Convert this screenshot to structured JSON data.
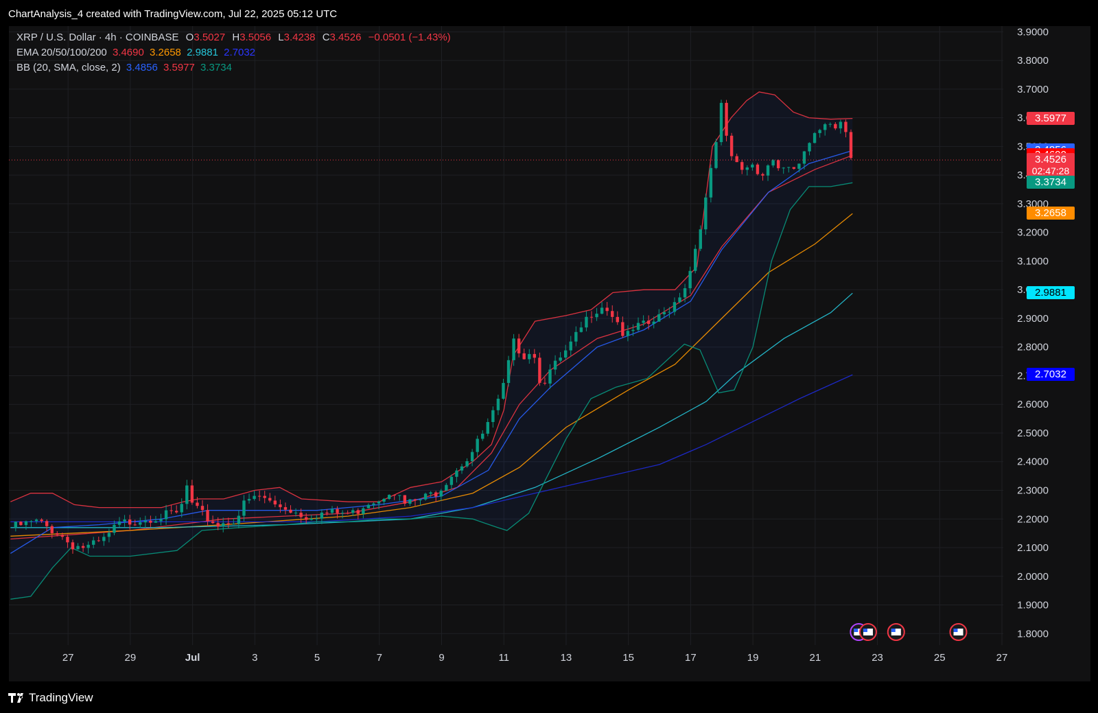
{
  "header": {
    "title": "ChartAnalysis_4 created with TradingView.com, Jul 22, 2025 05:12 UTC"
  },
  "legend": {
    "symbol": "XRP / U.S. Dollar · 4h · COINBASE",
    "o_label": "O",
    "o_value": "3.5027",
    "h_label": "H",
    "h_value": "3.5056",
    "l_label": "L",
    "l_value": "3.4238",
    "c_label": "C",
    "c_value": "3.4526",
    "change": "−0.0501 (−1.43%)",
    "ema_label": "EMA 20/50/100/200",
    "ema_values": [
      "3.4690",
      "3.2658",
      "2.9881",
      "2.7032"
    ],
    "bb_label": "BB (20, SMA, close, 2)",
    "bb_values": [
      "3.4856",
      "3.5977",
      "3.3734"
    ]
  },
  "price_tags": [
    {
      "text": "3.5977",
      "color": "#f23645",
      "value": 3.5977
    },
    {
      "text": "3.4856",
      "color": "#2962ff",
      "value": 3.4856
    },
    {
      "text": "3.4690",
      "color": "#ff0000",
      "value": 3.469
    },
    {
      "text": "3.4526",
      "sub": "02:47:28",
      "color": "#f23645",
      "value": 3.4526
    },
    {
      "text": "3.3734",
      "color": "#089981",
      "value": 3.3734
    },
    {
      "text": "3.2658",
      "color": "#ff8c00",
      "value": 3.2658
    },
    {
      "text": "2.9881",
      "color": "#00e5ff",
      "value": 2.9881
    },
    {
      "text": "2.7032",
      "color": "#0000ff",
      "value": 2.7032
    }
  ],
  "footer": {
    "brand": "TradingView"
  },
  "colors": {
    "up": "#089981",
    "down": "#f23645",
    "ema20": "#f23645",
    "ema50": "#ff9800",
    "ema100": "#26c6da",
    "ema200": "#1e2bd8",
    "bb_basis": "#2962ff",
    "bb_upper": "#f23645",
    "bb_lower": "#089981"
  },
  "chart_data": {
    "type": "candlestick",
    "symbol": "XRP / U.S. Dollar",
    "interval": "4h",
    "exchange": "COINBASE",
    "y_ticks": [
      "3.9000",
      "3.8000",
      "3.7000",
      "3.6000",
      "3.5000",
      "3.4000",
      "3.3000",
      "3.2000",
      "3.1000",
      "3.0000",
      "2.9000",
      "2.8000",
      "2.7000",
      "2.6000",
      "2.5000",
      "2.4000",
      "2.3000",
      "2.2000",
      "2.1000",
      "2.0000",
      "1.9000",
      "1.8000"
    ],
    "ylim": [
      1.76,
      3.92
    ],
    "x_ticks": [
      {
        "label": "27",
        "day": 27
      },
      {
        "label": "29",
        "day": 29
      },
      {
        "label": "Jul",
        "day": 31
      },
      {
        "label": "3",
        "day": 33
      },
      {
        "label": "5",
        "day": 35
      },
      {
        "label": "7",
        "day": 37
      },
      {
        "label": "9",
        "day": 39
      },
      {
        "label": "11",
        "day": 41
      },
      {
        "label": "13",
        "day": 43
      },
      {
        "label": "15",
        "day": 45
      },
      {
        "label": "17",
        "day": 47
      },
      {
        "label": "19",
        "day": 49
      },
      {
        "label": "21",
        "day": 51
      },
      {
        "label": "23",
        "day": 53
      },
      {
        "label": "25",
        "day": 55
      },
      {
        "label": "27",
        "day": 57
      }
    ],
    "xlim_days": [
      25.1,
      57.0
    ],
    "last_price": 3.4526,
    "close_points": [
      [
        25.15,
        2.17
      ],
      [
        26.0,
        2.19
      ],
      [
        26.7,
        2.15
      ],
      [
        27.1,
        2.11
      ],
      [
        27.6,
        2.1
      ],
      [
        28.1,
        2.12
      ],
      [
        28.6,
        2.18
      ],
      [
        29.3,
        2.2
      ],
      [
        30.0,
        2.21
      ],
      [
        30.6,
        2.22
      ],
      [
        30.8,
        2.32
      ],
      [
        31.0,
        2.24
      ],
      [
        31.5,
        2.2
      ],
      [
        31.8,
        2.18
      ],
      [
        32.4,
        2.2
      ],
      [
        32.7,
        2.26
      ],
      [
        33.2,
        2.28
      ],
      [
        33.6,
        2.25
      ],
      [
        34.0,
        2.24
      ],
      [
        34.6,
        2.21
      ],
      [
        35.2,
        2.22
      ],
      [
        35.8,
        2.22
      ],
      [
        36.2,
        2.22
      ],
      [
        36.6,
        2.26
      ],
      [
        37.0,
        2.27
      ],
      [
        37.4,
        2.31
      ],
      [
        37.8,
        2.25
      ],
      [
        38.4,
        2.27
      ],
      [
        38.9,
        2.3
      ],
      [
        39.4,
        2.37
      ],
      [
        39.9,
        2.42
      ],
      [
        40.4,
        2.51
      ],
      [
        40.8,
        2.6
      ],
      [
        41.1,
        2.7
      ],
      [
        41.3,
        2.85
      ],
      [
        41.6,
        2.76
      ],
      [
        41.9,
        2.8
      ],
      [
        42.2,
        2.67
      ],
      [
        42.6,
        2.73
      ],
      [
        43.0,
        2.78
      ],
      [
        43.4,
        2.85
      ],
      [
        43.8,
        2.92
      ],
      [
        44.2,
        2.95
      ],
      [
        44.6,
        2.9
      ],
      [
        44.9,
        2.83
      ],
      [
        45.3,
        2.87
      ],
      [
        45.7,
        2.88
      ],
      [
        46.1,
        2.91
      ],
      [
        46.5,
        2.96
      ],
      [
        46.9,
        3.03
      ],
      [
        47.2,
        3.17
      ],
      [
        47.5,
        3.32
      ],
      [
        47.8,
        3.5
      ],
      [
        48.0,
        3.65
      ],
      [
        48.2,
        3.48
      ],
      [
        48.6,
        3.42
      ],
      [
        49.0,
        3.44
      ],
      [
        49.3,
        3.4
      ],
      [
        49.6,
        3.46
      ],
      [
        49.9,
        3.42
      ],
      [
        50.2,
        3.41
      ],
      [
        50.5,
        3.44
      ],
      [
        50.8,
        3.5
      ],
      [
        51.1,
        3.55
      ],
      [
        51.4,
        3.6
      ],
      [
        51.7,
        3.57
      ],
      [
        51.9,
        3.6
      ],
      [
        52.1,
        3.5
      ],
      [
        52.2,
        3.4526
      ]
    ],
    "series": [
      {
        "name": "EMA 20",
        "last": 3.469,
        "points": [
          [
            25.15,
            2.13
          ],
          [
            29,
            2.16
          ],
          [
            32,
            2.2
          ],
          [
            36,
            2.22
          ],
          [
            38,
            2.26
          ],
          [
            39.5,
            2.31
          ],
          [
            40.6,
            2.43
          ],
          [
            41.5,
            2.6
          ],
          [
            42.5,
            2.72
          ],
          [
            44,
            2.83
          ],
          [
            45.5,
            2.88
          ],
          [
            47,
            2.98
          ],
          [
            48,
            3.15
          ],
          [
            49.5,
            3.34
          ],
          [
            51,
            3.42
          ],
          [
            52.2,
            3.469
          ]
        ]
      },
      {
        "name": "EMA 50",
        "last": 3.2658,
        "points": [
          [
            25.15,
            2.14
          ],
          [
            29,
            2.16
          ],
          [
            32,
            2.18
          ],
          [
            36,
            2.21
          ],
          [
            38,
            2.24
          ],
          [
            40,
            2.29
          ],
          [
            41.5,
            2.38
          ],
          [
            43,
            2.52
          ],
          [
            45,
            2.65
          ],
          [
            46.5,
            2.74
          ],
          [
            48,
            2.9
          ],
          [
            49.5,
            3.06
          ],
          [
            51,
            3.16
          ],
          [
            52.2,
            3.2658
          ]
        ]
      },
      {
        "name": "EMA 100",
        "last": 2.9881,
        "points": [
          [
            25.15,
            2.17
          ],
          [
            30,
            2.17
          ],
          [
            34,
            2.18
          ],
          [
            38,
            2.2
          ],
          [
            40,
            2.24
          ],
          [
            42,
            2.31
          ],
          [
            44,
            2.41
          ],
          [
            46,
            2.52
          ],
          [
            47.5,
            2.61
          ],
          [
            48.5,
            2.71
          ],
          [
            50,
            2.83
          ],
          [
            51.5,
            2.92
          ],
          [
            52.2,
            2.9881
          ]
        ]
      },
      {
        "name": "EMA 200",
        "last": 2.7032,
        "points": [
          [
            25.15,
            2.19
          ],
          [
            30,
            2.19
          ],
          [
            35,
            2.19
          ],
          [
            38,
            2.21
          ],
          [
            40,
            2.24
          ],
          [
            42,
            2.29
          ],
          [
            44,
            2.34
          ],
          [
            46,
            2.39
          ],
          [
            47.5,
            2.46
          ],
          [
            49,
            2.54
          ],
          [
            50.5,
            2.62
          ],
          [
            52.2,
            2.7032
          ]
        ]
      },
      {
        "name": "BB basis",
        "last": 3.4856,
        "points": [
          [
            25.15,
            2.08
          ],
          [
            26.5,
            2.17
          ],
          [
            28,
            2.18
          ],
          [
            30,
            2.2
          ],
          [
            31.5,
            2.23
          ],
          [
            33,
            2.23
          ],
          [
            35,
            2.23
          ],
          [
            37,
            2.25
          ],
          [
            39,
            2.28
          ],
          [
            40.5,
            2.37
          ],
          [
            41.5,
            2.55
          ],
          [
            42.5,
            2.66
          ],
          [
            44,
            2.8
          ],
          [
            45.5,
            2.86
          ],
          [
            47,
            2.96
          ],
          [
            48,
            3.14
          ],
          [
            49.5,
            3.34
          ],
          [
            50.8,
            3.44
          ],
          [
            52.2,
            3.4856
          ]
        ]
      },
      {
        "name": "BB upper",
        "last": 3.5977,
        "points": [
          [
            25.15,
            2.26
          ],
          [
            25.8,
            2.29
          ],
          [
            26.5,
            2.29
          ],
          [
            27.2,
            2.25
          ],
          [
            28,
            2.24
          ],
          [
            30,
            2.24
          ],
          [
            30.7,
            2.26
          ],
          [
            31.2,
            2.27
          ],
          [
            32,
            2.27
          ],
          [
            33,
            2.3
          ],
          [
            33.8,
            2.31
          ],
          [
            34.5,
            2.27
          ],
          [
            36,
            2.26
          ],
          [
            37,
            2.26
          ],
          [
            38,
            2.31
          ],
          [
            39,
            2.33
          ],
          [
            40,
            2.4
          ],
          [
            40.6,
            2.46
          ],
          [
            41.0,
            2.58
          ],
          [
            41.3,
            2.77
          ],
          [
            42.0,
            2.89
          ],
          [
            43.0,
            2.91
          ],
          [
            43.8,
            2.93
          ],
          [
            44.5,
            2.99
          ],
          [
            45.5,
            3.0
          ],
          [
            46.5,
            3.0
          ],
          [
            47.2,
            3.08
          ],
          [
            47.7,
            3.5
          ],
          [
            48.3,
            3.6
          ],
          [
            48.8,
            3.66
          ],
          [
            49.2,
            3.69
          ],
          [
            49.7,
            3.68
          ],
          [
            50.3,
            3.62
          ],
          [
            50.8,
            3.6
          ],
          [
            51.5,
            3.595
          ],
          [
            52.2,
            3.5977
          ]
        ]
      },
      {
        "name": "BB lower",
        "last": 3.3734,
        "points": [
          [
            25.15,
            1.92
          ],
          [
            25.8,
            1.93
          ],
          [
            26.5,
            2.03
          ],
          [
            27.1,
            2.1
          ],
          [
            27.7,
            2.07
          ],
          [
            29,
            2.07
          ],
          [
            30.5,
            2.09
          ],
          [
            31.3,
            2.16
          ],
          [
            32.5,
            2.17
          ],
          [
            34,
            2.18
          ],
          [
            35,
            2.19
          ],
          [
            36,
            2.19
          ],
          [
            37,
            2.2
          ],
          [
            38,
            2.2
          ],
          [
            39,
            2.21
          ],
          [
            40.0,
            2.2
          ],
          [
            40.8,
            2.17
          ],
          [
            41.1,
            2.16
          ],
          [
            41.8,
            2.22
          ],
          [
            42.4,
            2.35
          ],
          [
            43.0,
            2.48
          ],
          [
            43.8,
            2.62
          ],
          [
            44.6,
            2.66
          ],
          [
            45.6,
            2.69
          ],
          [
            46.3,
            2.76
          ],
          [
            46.8,
            2.81
          ],
          [
            47.3,
            2.79
          ],
          [
            47.9,
            2.64
          ],
          [
            48.4,
            2.65
          ],
          [
            49.0,
            2.8
          ],
          [
            49.6,
            3.1
          ],
          [
            50.2,
            3.28
          ],
          [
            50.8,
            3.36
          ],
          [
            51.5,
            3.36
          ],
          [
            52.2,
            3.3734
          ]
        ]
      }
    ]
  }
}
